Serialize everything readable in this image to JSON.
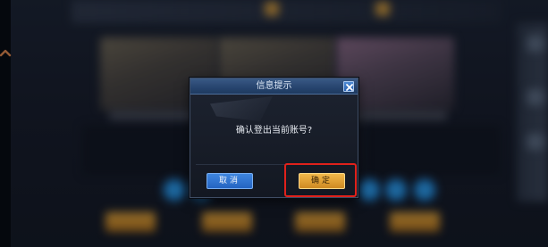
{
  "dialog": {
    "title": "信息提示",
    "message": "确认登出当前账号?",
    "cancel_label": "取消",
    "confirm_label": "确定",
    "close_icon": "close-icon"
  },
  "colors": {
    "header_blue": "#2a4a78",
    "cancel_blue": "#2f75d6",
    "confirm_gold": "#e3a236",
    "highlight_red": "#e0211b"
  },
  "icons": {
    "back": "back-arrow-icon",
    "close": "close-icon"
  }
}
